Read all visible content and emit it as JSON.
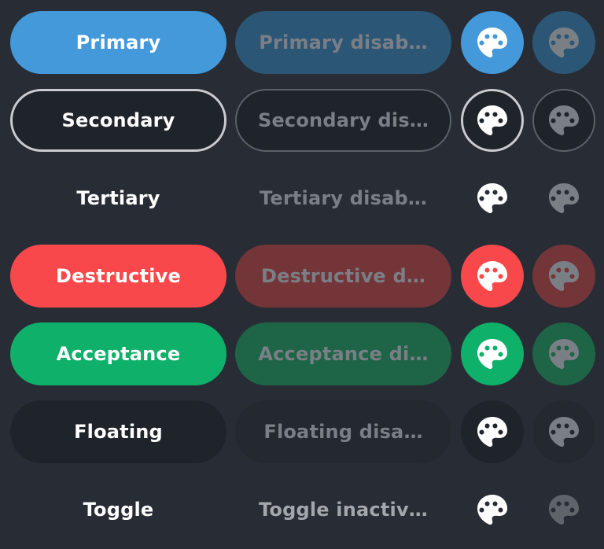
{
  "colors": {
    "background": "#282d35",
    "primary": "#4399da",
    "primary_disabled": "#2c5675",
    "secondary_border": "#c9cbce",
    "destructive": "#f8484b",
    "destructive_disabled": "#733538",
    "acceptance": "#0fb06a",
    "acceptance_disabled": "#1e6547",
    "floating": "#1f232a",
    "text_enabled": "#ffffff",
    "text_disabled": "#7a7f86"
  },
  "icon": "palette-icon",
  "rows": [
    {
      "variant": "primary",
      "label": "Primary",
      "disabled_label": "Primary disab…"
    },
    {
      "variant": "secondary",
      "label": "Secondary",
      "disabled_label": "Secondary dis…"
    },
    {
      "variant": "tertiary",
      "label": "Tertiary",
      "disabled_label": "Tertiary disab…"
    },
    {
      "variant": "destructive",
      "label": "Destructive",
      "disabled_label": "Destructive d…"
    },
    {
      "variant": "acceptance",
      "label": "Acceptance",
      "disabled_label": "Acceptance di…"
    },
    {
      "variant": "floating",
      "label": "Floating",
      "disabled_label": "Floating disa…"
    },
    {
      "variant": "toggle",
      "label": "Toggle",
      "disabled_label": "Toggle inactiv…"
    }
  ]
}
